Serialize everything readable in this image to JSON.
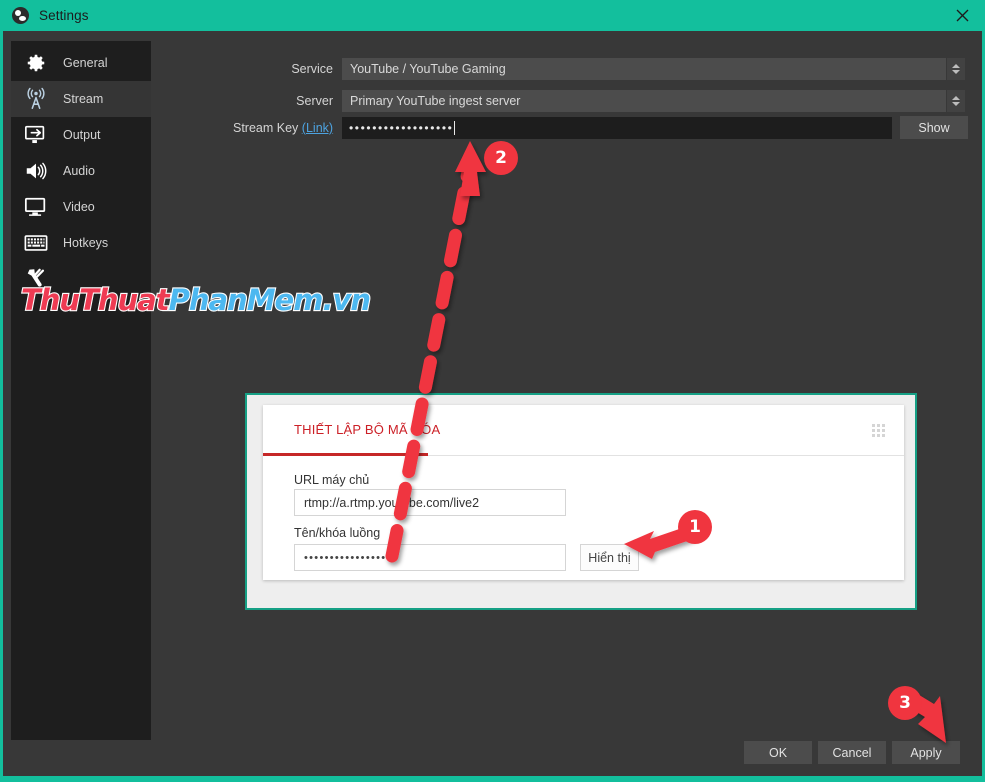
{
  "window": {
    "title": "Settings",
    "logo_icon": "obs-logo-icon",
    "close_icon": "close-icon"
  },
  "sidebar": {
    "items": [
      {
        "label": "General",
        "icon": "gear-icon",
        "selected": false
      },
      {
        "label": "Stream",
        "icon": "broadcast-icon",
        "selected": true
      },
      {
        "label": "Output",
        "icon": "output-icon",
        "selected": false
      },
      {
        "label": "Audio",
        "icon": "speaker-icon",
        "selected": false
      },
      {
        "label": "Video",
        "icon": "monitor-icon",
        "selected": false
      },
      {
        "label": "Hotkeys",
        "icon": "keyboard-icon",
        "selected": false
      },
      {
        "label": "",
        "icon": "wrench-icon",
        "selected": false
      }
    ]
  },
  "stream_settings": {
    "service_label": "Service",
    "service_value": "YouTube / YouTube Gaming",
    "server_label": "Server",
    "server_value": "Primary YouTube ingest server",
    "stream_key_label": "Stream Key",
    "stream_key_link": "(Link)",
    "stream_key_value": "••••••••••••••••••",
    "show_button": "Show"
  },
  "overlay": {
    "card_title": "THIẾT LẬP BỘ MÃ HÓA",
    "grid_icon": "grid-dots-icon",
    "server_url_label": "URL máy chủ",
    "server_url_value": "rtmp://a.rtmp.youtube.com/live2",
    "stream_name_label": "Tên/khóa luồng",
    "stream_name_value": "•••••••••••••••••",
    "show_button": "Hiển thị"
  },
  "footer": {
    "ok": "OK",
    "cancel": "Cancel",
    "apply": "Apply"
  },
  "annotations": {
    "step1": "1",
    "step2": "2",
    "step3": "3"
  },
  "watermark": {
    "part1": "ThuThuat",
    "part2": "PhanMem.vn"
  },
  "colors": {
    "accent_teal": "#13bf9d",
    "annotation_red": "#f0353f",
    "card_red": "#cc2027",
    "link_blue": "#4da3e0",
    "panel_bg": "#383838",
    "sidebar_bg": "#1e1e1e"
  }
}
